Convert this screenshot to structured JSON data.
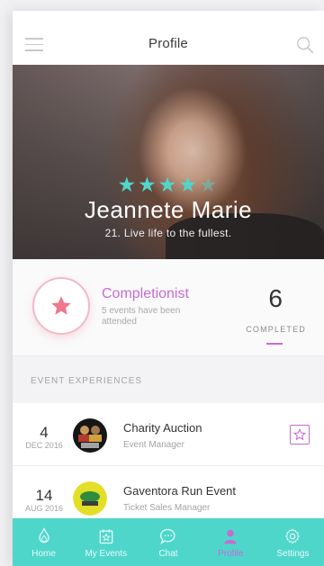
{
  "header": {
    "title": "Profile"
  },
  "hero": {
    "rating": 4.5,
    "rating_max": 5,
    "name": "Jeannete Marie",
    "tagline": "21. Live life to the fullest."
  },
  "badge": {
    "title": "Completionist",
    "description": "5 events have been attended",
    "count": "6",
    "count_label": "COMPLETED"
  },
  "section": {
    "title": "EVENT EXPERIENCES"
  },
  "events": [
    {
      "day": "4",
      "month_year": "DEC 2016",
      "name": "Charity Auction",
      "role": "Event Manager",
      "favorite": true
    },
    {
      "day": "14",
      "month_year": "AUG 2016",
      "name": "Gaventora Run Event",
      "role": "Ticket Sales Manager",
      "favorite": false
    }
  ],
  "tabs": [
    {
      "label": "Home",
      "icon": "flame-icon",
      "active": false
    },
    {
      "label": "My Events",
      "icon": "calendar-star-icon",
      "active": false
    },
    {
      "label": "Chat",
      "icon": "chat-bubble-icon",
      "active": false
    },
    {
      "label": "Profile",
      "icon": "person-icon",
      "active": true
    },
    {
      "label": "Settings",
      "icon": "gear-icon",
      "active": false
    }
  ],
  "colors": {
    "accent_teal": "#4fd6cb",
    "accent_purple": "#c66bd2",
    "badge_star": "#f0788c"
  }
}
